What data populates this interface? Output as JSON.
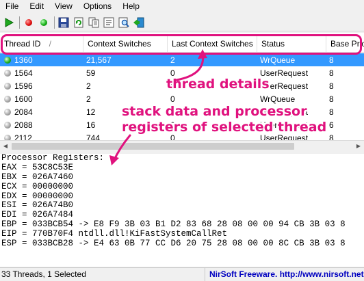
{
  "menu": [
    "File",
    "Edit",
    "View",
    "Options",
    "Help"
  ],
  "toolbar": {
    "icons": [
      "play-icon",
      "stop-red-icon",
      "go-green-icon",
      "save-icon",
      "refresh-icon",
      "copy-icon",
      "properties-icon",
      "find-icon",
      "exit-icon"
    ]
  },
  "columns": [
    "Thread ID",
    "Context Switches",
    "Last Context Switches",
    "Status",
    "Base Prio"
  ],
  "rows": [
    {
      "id": "1360",
      "cs": "21,567",
      "lcs": "2",
      "status": "WrQueue",
      "prio": "8",
      "selected": true,
      "active": true
    },
    {
      "id": "1564",
      "cs": "59",
      "lcs": "0",
      "status": "UserRequest",
      "prio": "8"
    },
    {
      "id": "1596",
      "cs": "2",
      "lcs": "0",
      "status": "UserRequest",
      "prio": "8"
    },
    {
      "id": "1600",
      "cs": "2",
      "lcs": "0",
      "status": "WrQueue",
      "prio": "8"
    },
    {
      "id": "2084",
      "cs": "12",
      "lcs": "0",
      "status": "UserRequest",
      "prio": "8"
    },
    {
      "id": "2088",
      "cs": "16",
      "lcs": "0",
      "status": "UserRequest",
      "prio": "6"
    },
    {
      "id": "2112",
      "cs": "744",
      "lcs": "0",
      "status": "UserRequest",
      "prio": "8"
    }
  ],
  "details_lines": [
    "Processor Registers:",
    "EAX = 53C8C53E",
    "EBX = 026A7460",
    "ECX = 00000000",
    "EDX = 00000000",
    "ESI = 026A74B0",
    "EDI = 026A7484",
    "EBP = 033BCB54 -> E8 F9 3B 03 B1 D2 83 68 28 08 00 00 94 CB 3B 03 8",
    "EIP = 770B70F4 ntdll.dll!KiFastSystemCallRet",
    "ESP = 033BCB28 -> E4 63 0B 77 CC D6 20 75 28 08 00 00 8C CB 3B 03 8"
  ],
  "status": {
    "left": "33 Threads, 1 Selected",
    "right": "NirSoft Freeware.  http://www.nirsoft.net"
  },
  "annotations": {
    "thread_details": "thread details",
    "stack_line1": "stack data and processor",
    "stack_line2": "registers of selected thread",
    "color": "#e0127e"
  }
}
